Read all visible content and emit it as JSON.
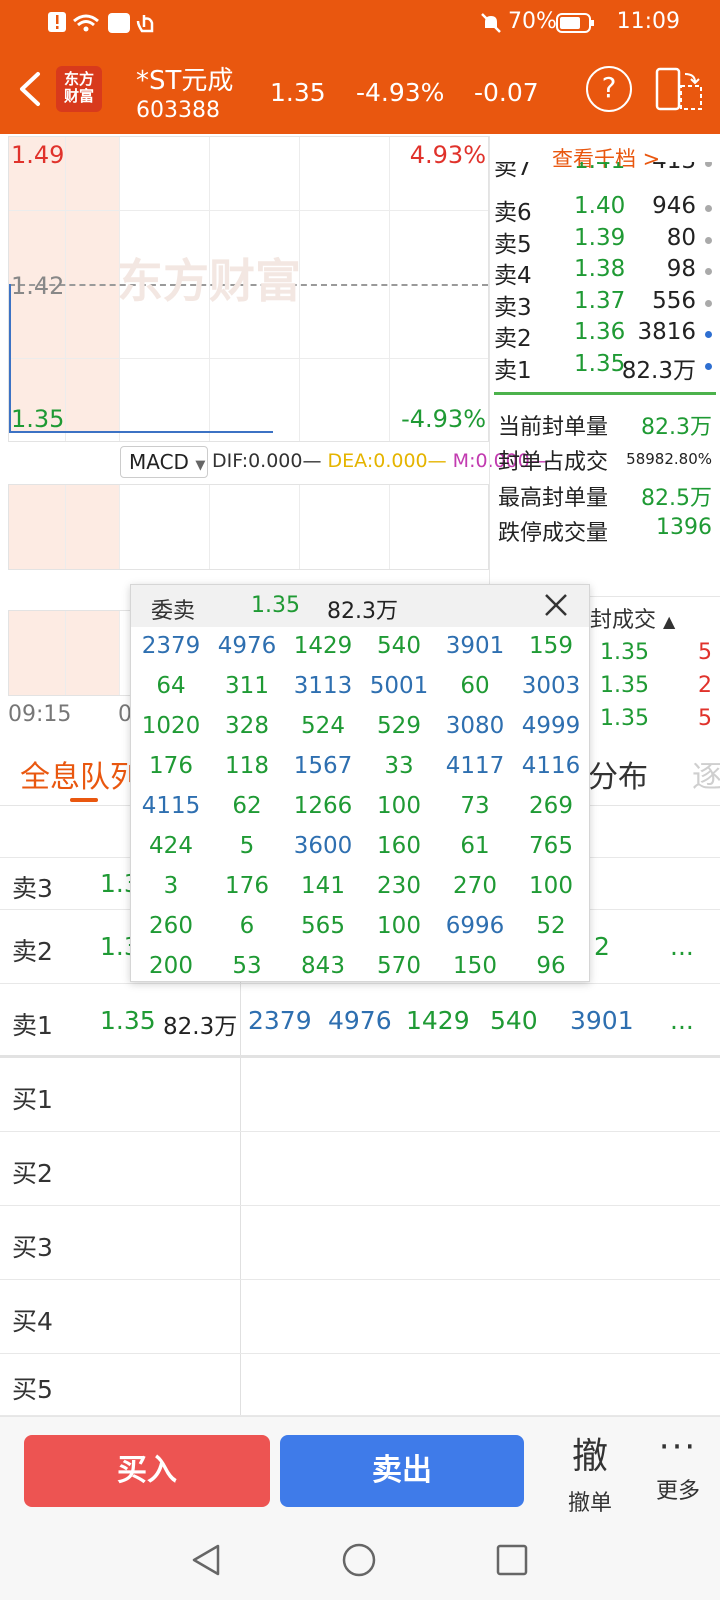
{
  "status_bar": {
    "battery": "70%",
    "time": "11:09"
  },
  "header": {
    "logo_line1": "东方",
    "logo_line2": "财富",
    "name": "*ST元成",
    "code": "603388",
    "price": "1.35",
    "change_pct": "-4.93%",
    "change": "-0.07"
  },
  "chart": {
    "top_price": "1.49",
    "top_pct": "4.93%",
    "mid_price": "1.42",
    "bottom_price": "1.35",
    "bottom_pct": "-4.93%",
    "watermark": "东方财富",
    "time_start": "09:15",
    "time_partial": "0",
    "indicator": "MACD",
    "dif": "DIF:0.000",
    "dea": "DEA:0.000",
    "m": "M:0.000"
  },
  "order_book": {
    "view_link": "查看千档 >",
    "rows": [
      {
        "label": "卖7",
        "price": "1.41",
        "vol": "413"
      },
      {
        "label": "卖6",
        "price": "1.40",
        "vol": "946"
      },
      {
        "label": "卖5",
        "price": "1.39",
        "vol": "80"
      },
      {
        "label": "卖4",
        "price": "1.38",
        "vol": "98"
      },
      {
        "label": "卖3",
        "price": "1.37",
        "vol": "556"
      },
      {
        "label": "卖2",
        "price": "1.36",
        "vol": "3816"
      },
      {
        "label": "卖1",
        "price": "1.35",
        "vol": "82.3万"
      }
    ],
    "stats": [
      {
        "key": "当前封单量",
        "value": "82.3万"
      },
      {
        "key": "封单占成交",
        "value": "58982.80%"
      },
      {
        "key": "最高封单量",
        "value": "82.5万"
      },
      {
        "key": "跌停成交量",
        "value": "1396"
      }
    ],
    "deals_header": "封成交",
    "deals": [
      {
        "price": "1.35",
        "vol": "5"
      },
      {
        "price": "1.35",
        "vol": "2"
      },
      {
        "price": "1.35",
        "vol": "5"
      }
    ]
  },
  "tabs": {
    "active": "全息队列",
    "right": "分布",
    "faded": "逐"
  },
  "queue": {
    "rows": [
      {
        "label": "卖3",
        "price": "1.3",
        "vol": "",
        "items": []
      },
      {
        "label": "卖2",
        "price": "1.3",
        "vol": "",
        "tail": "2",
        "more": "..."
      },
      {
        "label": "卖1",
        "price": "1.35",
        "vol": "82.3万",
        "items": [
          "2379",
          "4976",
          "1429",
          "540",
          "3901"
        ],
        "more": "..."
      },
      {
        "label": "买1"
      },
      {
        "label": "买2"
      },
      {
        "label": "买3"
      },
      {
        "label": "买4"
      },
      {
        "label": "买5"
      }
    ]
  },
  "popup": {
    "title": "委卖",
    "price": "1.35",
    "vol": "82.3万",
    "grid": [
      [
        "2379",
        "4976",
        "1429",
        "540",
        "3901",
        "159"
      ],
      [
        "64",
        "311",
        "3113",
        "5001",
        "60",
        "3003"
      ],
      [
        "1020",
        "328",
        "524",
        "529",
        "3080",
        "4999"
      ],
      [
        "176",
        "118",
        "1567",
        "33",
        "4117",
        "4116"
      ],
      [
        "4115",
        "62",
        "1266",
        "100",
        "73",
        "269"
      ],
      [
        "424",
        "5",
        "3600",
        "160",
        "61",
        "765"
      ],
      [
        "3",
        "176",
        "141",
        "230",
        "270",
        "100"
      ],
      [
        "260",
        "6",
        "565",
        "100",
        "6996",
        "52"
      ],
      [
        "200",
        "53",
        "843",
        "570",
        "150",
        "96"
      ]
    ]
  },
  "bottom": {
    "buy": "买入",
    "sell": "卖出",
    "cancel_icon": "撤",
    "cancel": "撤单",
    "more_icon": "···",
    "more": "更多"
  }
}
